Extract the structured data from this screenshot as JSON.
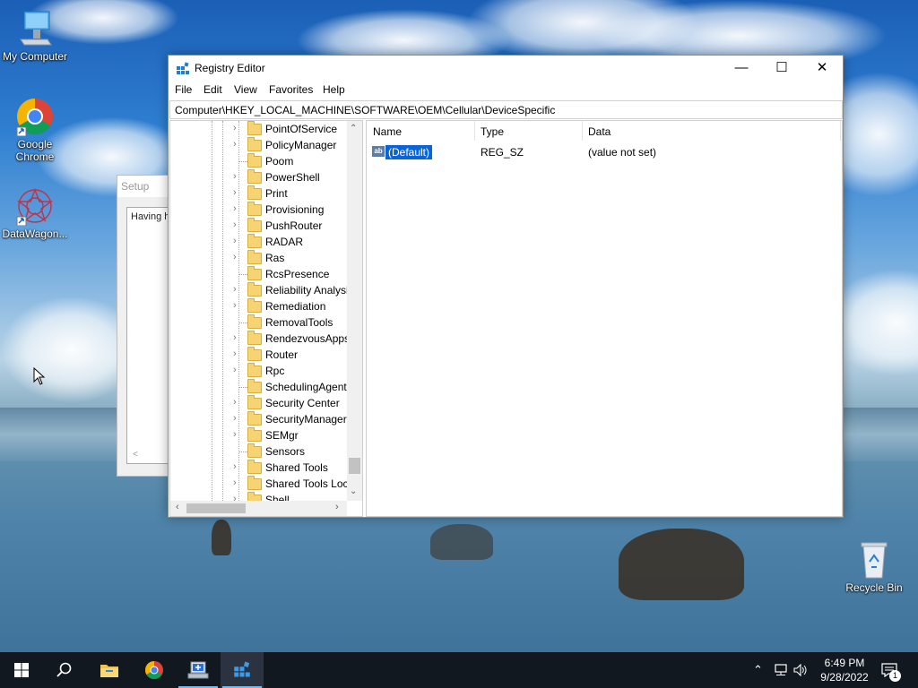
{
  "desktop": {
    "icons": [
      {
        "label": "My Computer"
      },
      {
        "label": "Google\nChrome"
      },
      {
        "label": "DataWagon..."
      },
      {
        "label": "Recycle Bin"
      }
    ]
  },
  "setup_window": {
    "title": "Setup",
    "text": "Having h"
  },
  "registry": {
    "title": "Registry Editor",
    "menu": [
      "File",
      "Edit",
      "View",
      "Favorites",
      "Help"
    ],
    "address": "Computer\\HKEY_LOCAL_MACHINE\\SOFTWARE\\OEM\\Cellular\\DeviceSpecific",
    "tree": [
      {
        "label": "PointOfService",
        "expandable": true
      },
      {
        "label": "PolicyManager",
        "expandable": true
      },
      {
        "label": "Poom",
        "expandable": false
      },
      {
        "label": "PowerShell",
        "expandable": true
      },
      {
        "label": "Print",
        "expandable": true
      },
      {
        "label": "Provisioning",
        "expandable": true
      },
      {
        "label": "PushRouter",
        "expandable": true
      },
      {
        "label": "RADAR",
        "expandable": true
      },
      {
        "label": "Ras",
        "expandable": true
      },
      {
        "label": "RcsPresence",
        "expandable": false
      },
      {
        "label": "Reliability Analysi",
        "expandable": true
      },
      {
        "label": "Remediation",
        "expandable": true
      },
      {
        "label": "RemovalTools",
        "expandable": false
      },
      {
        "label": "RendezvousApps",
        "expandable": true
      },
      {
        "label": "Router",
        "expandable": true
      },
      {
        "label": "Rpc",
        "expandable": true
      },
      {
        "label": "SchedulingAgent",
        "expandable": false
      },
      {
        "label": "Security Center",
        "expandable": true
      },
      {
        "label": "SecurityManager",
        "expandable": true
      },
      {
        "label": "SEMgr",
        "expandable": true
      },
      {
        "label": "Sensors",
        "expandable": false
      },
      {
        "label": "Shared Tools",
        "expandable": true
      },
      {
        "label": "Shared Tools Loca",
        "expandable": true
      },
      {
        "label": "Shell",
        "expandable": true
      }
    ],
    "columns": [
      "Name",
      "Type",
      "Data"
    ],
    "values": [
      {
        "name": "(Default)",
        "type": "REG_SZ",
        "data": "(value not set)",
        "icon": "ab"
      }
    ]
  },
  "taskbar": {
    "time": "6:49 PM",
    "date": "9/28/2022",
    "notification_count": "1"
  }
}
